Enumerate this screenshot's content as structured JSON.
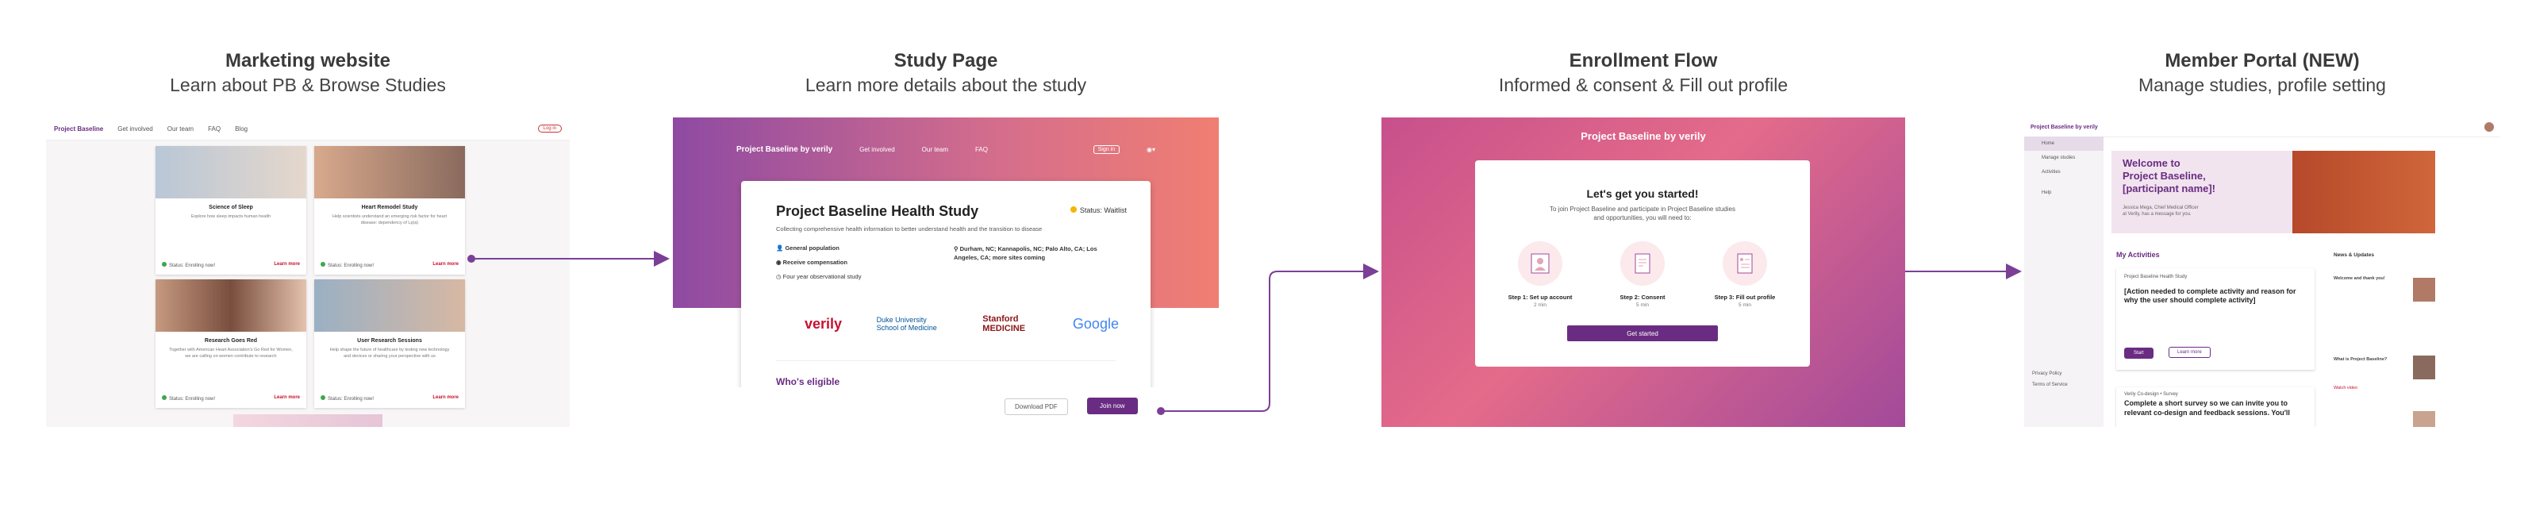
{
  "columns": [
    {
      "title": "Marketing website",
      "subtitle": "Learn about PB & Browse Studies"
    },
    {
      "title": "Study Page",
      "subtitle": "Learn more details about the study"
    },
    {
      "title": "Enrollment Flow",
      "subtitle": "Informed & consent & Fill out profile"
    },
    {
      "title": "Member Portal (NEW)",
      "subtitle": "Manage studies, profile setting"
    }
  ],
  "marketing": {
    "logo": "Project Baseline",
    "nav": [
      "Get involved",
      "Our team",
      "FAQ",
      "Blog"
    ],
    "login": "Log in",
    "cards": [
      {
        "title": "Science of Sleep",
        "desc": "Explore how sleep impacts human health",
        "status": "Status: Enrolling now!",
        "link": "Learn more"
      },
      {
        "title": "Heart Remodel Study",
        "desc": "Help scientists understand an emerging risk factor for heart disease: dependency of Lp(a)",
        "status": "Status: Enrolling now!",
        "link": "Learn more"
      },
      {
        "title": "Research Goes Red",
        "desc": "Together with American Heart Association's Go Red for Women, we are calling on women contribute to research",
        "status": "Status: Enrolling now!",
        "link": "Learn more"
      },
      {
        "title": "User Research Sessions",
        "desc": "Help shape the future of healthcare by testing new technology and devices or sharing your perspective with us",
        "status": "Status: Enrolling now!",
        "link": "Learn more"
      }
    ]
  },
  "study": {
    "logo": "Project Baseline by verily",
    "nav": [
      "Get involved",
      "Our team",
      "FAQ"
    ],
    "signin": "Sign in",
    "title": "Project Baseline Health Study",
    "status": "Status: Waitlist",
    "desc": "Collecting comprehensive health information to better understand health and the transition to disease",
    "items": [
      "General population",
      "Receive compensation",
      "Four year observational study",
      "Durham, NC; Kannapolis, NC; Palo Alto, CA; Los Angeles, CA; more sites coming"
    ],
    "logos": [
      "verily",
      "Duke University School of Medicine",
      "Stanford MEDICINE",
      "Google"
    ],
    "eligible": "Who's eligible",
    "download": "Download PDF",
    "join": "Join now"
  },
  "enrollment": {
    "logo": "Project Baseline by verily",
    "heading": "Let's get you started!",
    "desc": "To join Project Baseline and participate in Project Baseline studies and opportunities, you will need to:",
    "steps": [
      {
        "title": "Step 1: Set up account",
        "meta": "2 min"
      },
      {
        "title": "Step 2: Consent",
        "meta": "5 min"
      },
      {
        "title": "Step 3: Fill out profile",
        "meta": "5 min"
      }
    ],
    "button": "Get started"
  },
  "portal": {
    "logo": "Project Baseline by verily",
    "side": [
      "Home",
      "Manage studies",
      "Activities",
      "Help",
      "Privacy Policy",
      "Terms of Service"
    ],
    "welcome": "Welcome to Project Baseline, [participant name]!",
    "welcome_desc": "Jessica Mega, Chief Medical Officer at Verily, has a message for you.",
    "activities_title": "My Activities",
    "activity1_study": "Project Baseline Health Study",
    "activity1_title": "[Action needed to complete activity and reason for why the user should complete activity]",
    "activity1_start": "Start",
    "activity1_learn": "Learn more",
    "activity2_study": "Verily Co-design • Survey",
    "activity2_title": "Complete a short survey so we can invite you to relevant co-design and feedback sessions. You'll",
    "news_title": "News & Updates",
    "news": [
      "Welcome and thank you!",
      "What is Project Baseline?"
    ],
    "watch": "Watch video"
  },
  "colors": {
    "brand": "#6a2c82",
    "connector": "#7b3f97",
    "accent": "#c8102e"
  }
}
